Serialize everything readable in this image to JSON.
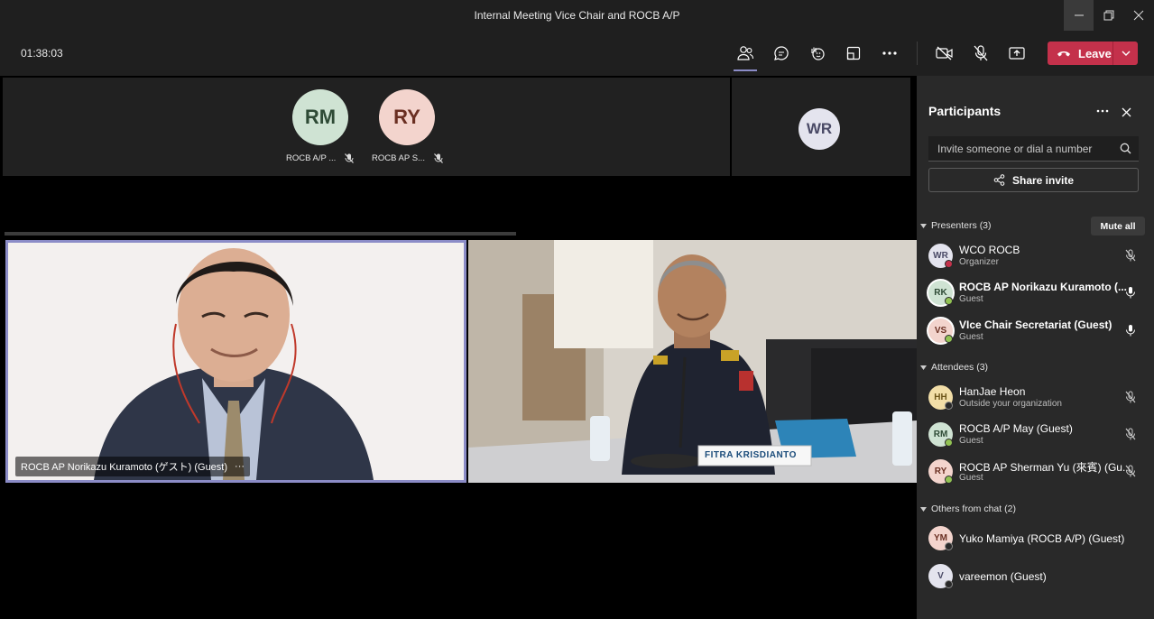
{
  "window": {
    "title": "Internal Meeting Vice Chair and ROCB A/P",
    "minimize_icon": "minimize-icon",
    "restore_icon": "restore-icon",
    "close_icon": "close-icon"
  },
  "toolbar": {
    "timer": "01:38:03",
    "leave_label": "Leave",
    "accent_color": "#8b8cc7",
    "leave_color": "#c4314b"
  },
  "stage": {
    "strip": [
      {
        "initials": "RM",
        "name": "ROCB A/P ..."
      },
      {
        "initials": "RY",
        "name": "ROCB AP S..."
      }
    ],
    "side_tile": {
      "initials": "WR"
    },
    "video_tiles": [
      {
        "name": "ROCB AP Norikazu Kuramoto (ゲスト) (Guest)",
        "more": "···"
      },
      {
        "placard": "FITRA KRISDIANTO"
      }
    ]
  },
  "panel": {
    "title": "Participants",
    "invite_placeholder": "Invite someone or dial a number",
    "share_invite": "Share invite",
    "mute_all": "Mute all",
    "sections": {
      "presenters": "Presenters (3)",
      "attendees": "Attendees (3)",
      "others": "Others from chat (2)"
    },
    "presenters": [
      {
        "initials": "WR",
        "name": "WCO ROCB",
        "role": "Organizer"
      },
      {
        "initials": "RK",
        "name": "ROCB AP Norikazu Kuramoto (...",
        "role": "Guest"
      },
      {
        "initials": "VS",
        "name": "VIce Chair Secretariat (Guest)",
        "role": "Guest"
      }
    ],
    "attendees": [
      {
        "initials": "HH",
        "name": "HanJae Heon",
        "role": "Outside your organization"
      },
      {
        "initials": "RM",
        "name": "ROCB A/P May (Guest)",
        "role": "Guest"
      },
      {
        "initials": "RY",
        "name": "ROCB AP Sherman Yu (來賓) (Gu...",
        "role": "Guest"
      }
    ],
    "others": [
      {
        "initials": "YM",
        "name": "Yuko Mamiya (ROCB A/P) (Guest)"
      },
      {
        "initials": "V",
        "name": "vareemon (Guest)"
      }
    ]
  }
}
